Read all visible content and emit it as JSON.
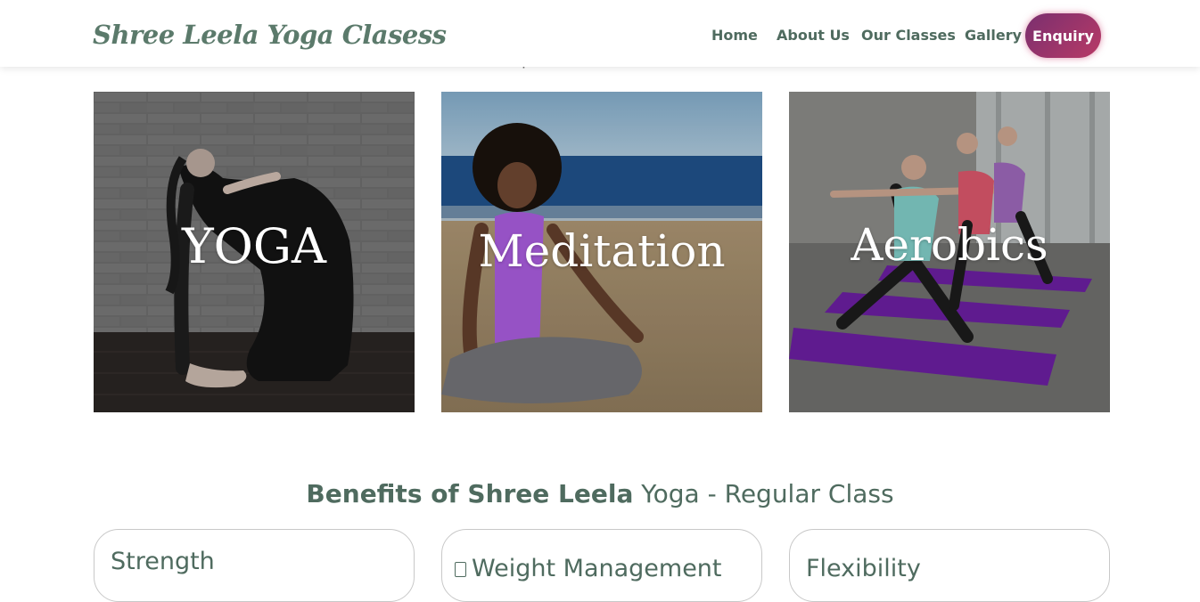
{
  "header": {
    "logo_text": "Shree Leela Yoga Clasess",
    "nav": {
      "home": "Home",
      "about": "About Us",
      "classes": "Our Classes",
      "gallery": "Gallery",
      "enquiry": "Enquiry"
    }
  },
  "intro_tail": "peace and calmness.",
  "classes": [
    {
      "label": "YOGA"
    },
    {
      "label": "Meditation"
    },
    {
      "label": "Aerobics"
    }
  ],
  "benefits": {
    "title_bold": "Benefits of Shree Leela",
    "title_rest": "Yoga - Regular Class",
    "cards": [
      {
        "title": "Strength"
      },
      {
        "title": "Weight Management"
      },
      {
        "title": "Flexibility"
      }
    ]
  },
  "colors": {
    "brand_green": "#4f6b5f",
    "enquiry_gradient_start": "#7a2f6f",
    "enquiry_gradient_end": "#b83a66",
    "mat_purple": "#6a1fa0",
    "top_purple": "#a35ad6",
    "sea_blue": "#1f4f86"
  }
}
